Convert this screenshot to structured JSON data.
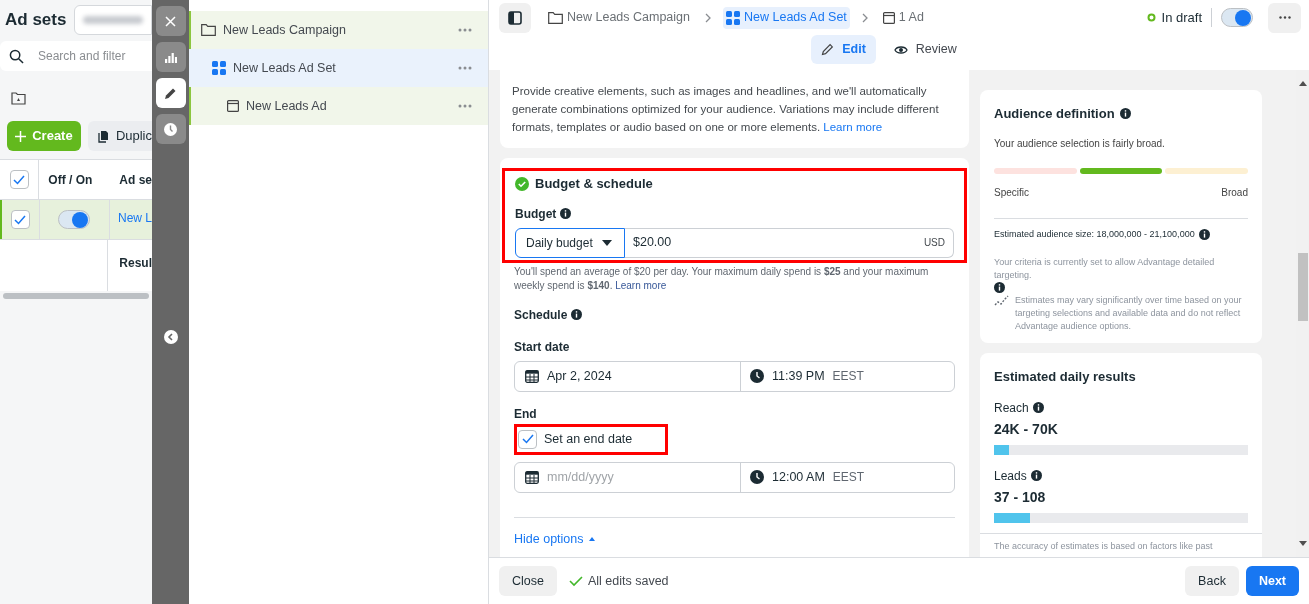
{
  "left_panel": {
    "title": "Ad sets",
    "search": {
      "placeholder": "Search and filter"
    },
    "create_button": "Create",
    "duplicate_button": "Duplic",
    "table": {
      "header": {
        "checked": true,
        "columns": [
          "Off / On",
          "Ad se"
        ]
      },
      "rows": [
        {
          "checked": true,
          "on": true,
          "name": "New L"
        }
      ],
      "footer_label": "Resul"
    }
  },
  "tool_strip": [
    {
      "kind": "close",
      "selected": false
    },
    {
      "kind": "chart",
      "selected": false
    },
    {
      "kind": "edit",
      "selected": true
    },
    {
      "kind": "history",
      "selected": false
    }
  ],
  "tree": {
    "items": [
      {
        "kind": "campaign",
        "label": "New Leads Campaign",
        "selected": false,
        "children": [
          {
            "kind": "adset",
            "label": "New Leads Ad Set",
            "selected": true,
            "children": [
              {
                "kind": "ad",
                "label": "New Leads Ad",
                "selected": false
              }
            ]
          }
        ]
      }
    ]
  },
  "header": {
    "breadcrumbs": [
      {
        "kind": "campaign",
        "label": "New Leads Campaign",
        "selected": false
      },
      {
        "kind": "adset",
        "label": "New Leads Ad Set",
        "selected": true
      },
      {
        "kind": "ad",
        "label": "1 Ad",
        "selected": false
      }
    ],
    "status": "In draft",
    "toggle": {
      "on": true
    },
    "mode_tabs": [
      {
        "kind": "edit",
        "label": "Edit",
        "selected": true
      },
      {
        "kind": "review",
        "label": "Review",
        "selected": false
      }
    ]
  },
  "editor": {
    "dynamic_creative": {
      "description": "Provide creative elements, such as images and headlines, and we'll automatically generate combinations optimized for your audience. Variations may include different formats, templates or audio based on one or more elements.",
      "link": "Learn more"
    },
    "budget_schedule": {
      "title": "Budget & schedule",
      "complete": true,
      "highlighted": true,
      "budget_label": "Budget",
      "budget_type": "Daily budget",
      "amount": "$20.00",
      "currency": "USD",
      "note": "You'll spend an average of $20 per day. Your maximum daily spend is **$25** and your maximum weekly spend is **$140**.",
      "note_link": "Learn more",
      "schedule_label": "Schedule",
      "start_label": "Start date",
      "start_date": "Apr 2, 2024",
      "start_time": "11:39 PM",
      "start_tz": "EEST",
      "end_label": "End",
      "end_checkbox": {
        "label": "Set an end date",
        "checked": true,
        "highlighted": true
      },
      "end_date_placeholder": "mm/dd/yyyy",
      "end_time": "12:00 AM",
      "end_tz": "EEST",
      "hide_options": "Hide options"
    }
  },
  "side_panel": {
    "audience": {
      "title": "Audience definition",
      "summary": "Your audience selection is fairly broad.",
      "segments": [
        {
          "selected": false
        },
        {
          "selected": true
        },
        {
          "selected": false
        }
      ],
      "min_label": "Specific",
      "max_label": "Broad",
      "size": "Estimated audience size: 18,000,000 - 21,100,000",
      "criteria": "Your criteria is currently set to allow Advantage detailed targeting.",
      "disclaimer": "Estimates may vary significantly over time based on your targeting selections and available data and do not reflect Advantage audience options."
    },
    "results": {
      "title": "Estimated daily results",
      "metrics": [
        {
          "label": "Reach",
          "value": "24K - 70K",
          "level": 0.06
        },
        {
          "label": "Leads",
          "value": "37 - 108",
          "level": 0.14
        }
      ],
      "accuracy_note": "The accuracy of estimates is based on factors like past"
    }
  },
  "footer": {
    "close": "Close",
    "save_status": "All edits saved",
    "back": "Back",
    "next": "Next"
  }
}
